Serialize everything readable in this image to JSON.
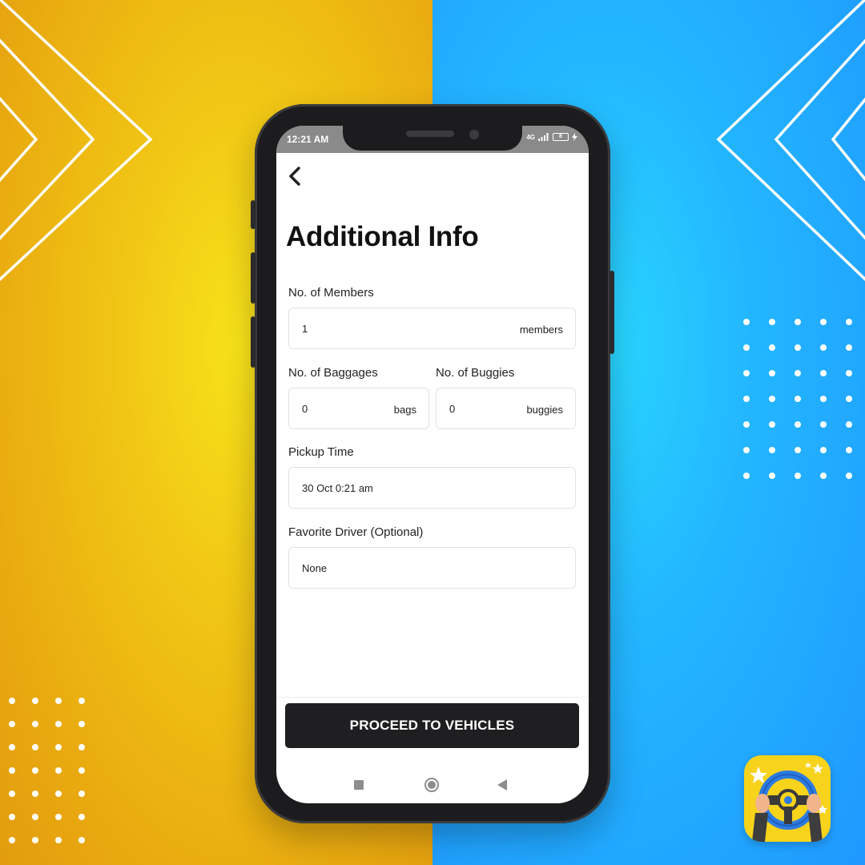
{
  "status_bar": {
    "time": "12:21 AM",
    "network": "4G",
    "battery": "8"
  },
  "header": {
    "title": "Additional Info"
  },
  "form": {
    "members": {
      "label": "No. of Members",
      "value": "1",
      "unit": "members"
    },
    "baggages": {
      "label": "No. of Baggages",
      "value": "0",
      "unit": "bags"
    },
    "buggies": {
      "label": "No. of Buggies",
      "value": "0",
      "unit": "buggies"
    },
    "pickup_time": {
      "label": "Pickup Time",
      "value": "30 Oct 0:21 am"
    },
    "favorite_driver": {
      "label": "Favorite Driver (Optional)",
      "value": "None"
    }
  },
  "actions": {
    "proceed_label": "PROCEED TO VEHICLES"
  },
  "colors": {
    "left_bg": "#f1c615",
    "right_bg": "#23b6ff",
    "button_bg": "#1f1f21",
    "logo_bg": "#f7d31c"
  },
  "icons": [
    "back-arrow-icon",
    "signal-icon",
    "battery-icon",
    "nav-recents-icon",
    "nav-home-icon",
    "nav-back-icon",
    "steering-wheel-logo-icon"
  ]
}
